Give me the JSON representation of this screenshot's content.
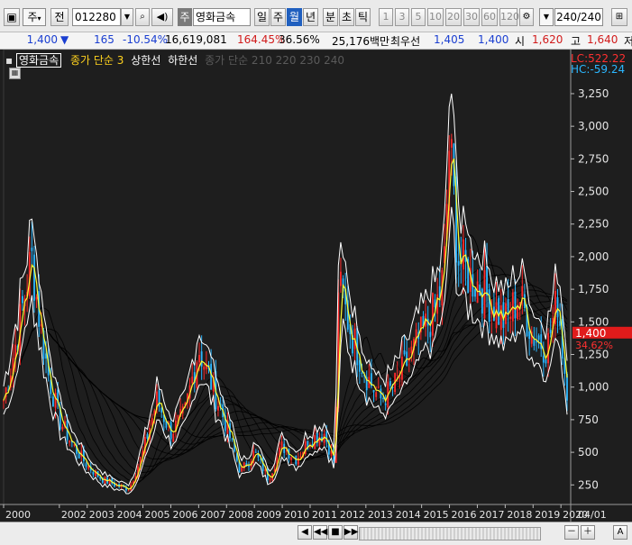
{
  "toolbar": {
    "period_select": "주",
    "prev_label": "전",
    "stock_code": "012280",
    "type_badge": "주",
    "stock_name": "영화금속",
    "tabs": [
      "일",
      "주",
      "월",
      "년",
      "분",
      "초",
      "틱"
    ],
    "active_tab": "월",
    "interval_buttons": [
      "1",
      "3",
      "5",
      "10",
      "20",
      "30",
      "60",
      "120"
    ],
    "count_value": "240/240"
  },
  "infobar": {
    "price": "1,400",
    "direction": "▼",
    "change": "165",
    "change_pct": "-10.54%",
    "volume": "16,619,081",
    "volume_ratio": "164.45%",
    "turnover": "36.56%",
    "amount": "25,176백만",
    "pref_label": "최우선",
    "bid": "1,405",
    "ask": "1,400",
    "open_label": "시",
    "open": "1,620",
    "high_label": "고",
    "high": "1,640",
    "truncated": "저"
  },
  "legend": {
    "name": "영화금속",
    "line1": "종가 단순 3",
    "line2": "상한선",
    "line3": "하한선",
    "line4": "종가 단순 210  220  230  240"
  },
  "chart_data": {
    "type": "line",
    "title": "",
    "xlabel": "",
    "ylabel": "",
    "ylim": [
      100,
      3450
    ],
    "yticks": [
      250,
      500,
      750,
      1000,
      1250,
      1500,
      1750,
      2000,
      2250,
      2500,
      2750,
      3000,
      3250
    ],
    "ytick_labels": [
      "250",
      "500",
      "750",
      "1,000",
      "1,250",
      "1,500",
      "1,750",
      "2,000",
      "2,250",
      "2,500",
      "2,750",
      "3,000",
      "3,250"
    ],
    "xtick_labels": [
      "2000",
      "2002",
      "2003",
      "2004",
      "2005",
      "2006",
      "2007",
      "2008",
      "2009",
      "2010",
      "2011",
      "2012",
      "2013",
      "2014",
      "2015",
      "2016",
      "2017",
      "2018",
      "2019",
      "2020"
    ],
    "xtick_years": [
      2000,
      2002,
      2003,
      2004,
      2005,
      2006,
      2007,
      2008,
      2009,
      2010,
      2011,
      2012,
      2013,
      2014,
      2015,
      2016,
      2017,
      2018,
      2019,
      2020
    ],
    "corner_label": "04/01",
    "lc_label": "LC:522.22",
    "hc_label": "HC:-59.24",
    "current_price": 1400,
    "current_price_label": "1,400",
    "current_pct_label": "34.62%",
    "series": [
      {
        "name": "종가",
        "x": [
          2000.0,
          2000.5,
          2001.0,
          2001.3,
          2001.6,
          2002.0,
          2002.5,
          2003.0,
          2003.5,
          2004.0,
          2004.5,
          2005.0,
          2005.5,
          2006.0,
          2006.5,
          2007.0,
          2007.5,
          2008.0,
          2008.5,
          2009.0,
          2009.5,
          2010.0,
          2010.5,
          2011.0,
          2011.5,
          2011.9,
          2012.0,
          2012.5,
          2013.0,
          2013.5,
          2014.0,
          2014.5,
          2015.0,
          2015.5,
          2015.8,
          2016.0,
          2016.3,
          2016.7,
          2017.0,
          2017.5,
          2018.0,
          2018.5,
          2019.0,
          2019.5,
          2019.9,
          2020.0,
          2020.2
        ],
        "values": [
          900,
          1400,
          2000,
          1500,
          1100,
          750,
          550,
          400,
          300,
          250,
          220,
          500,
          900,
          650,
          800,
          1300,
          1000,
          700,
          350,
          500,
          300,
          550,
          450,
          600,
          650,
          400,
          1800,
          1400,
          1100,
          900,
          1000,
          1200,
          1400,
          1600,
          1850,
          2900,
          2000,
          1850,
          1800,
          1650,
          1500,
          1700,
          1400,
          1300,
          1700,
          1400,
          1000
        ]
      }
    ]
  },
  "bottombar": {
    "buttons": [
      "◀",
      "◀◀",
      "■",
      "▶▶",
      "－",
      "＋",
      "A"
    ]
  },
  "colors": {
    "chart_bg": "#1e1e1e",
    "up": "#ff2a2a",
    "down": "#2bb7ff",
    "ma3": "#ffff33",
    "upper": "#ffffff",
    "lower": "#ffffff",
    "ma_long": "#000000",
    "price_tag": "#e11b1b",
    "info_blue": "#1b3fd1",
    "info_red": "#d11b1b"
  }
}
